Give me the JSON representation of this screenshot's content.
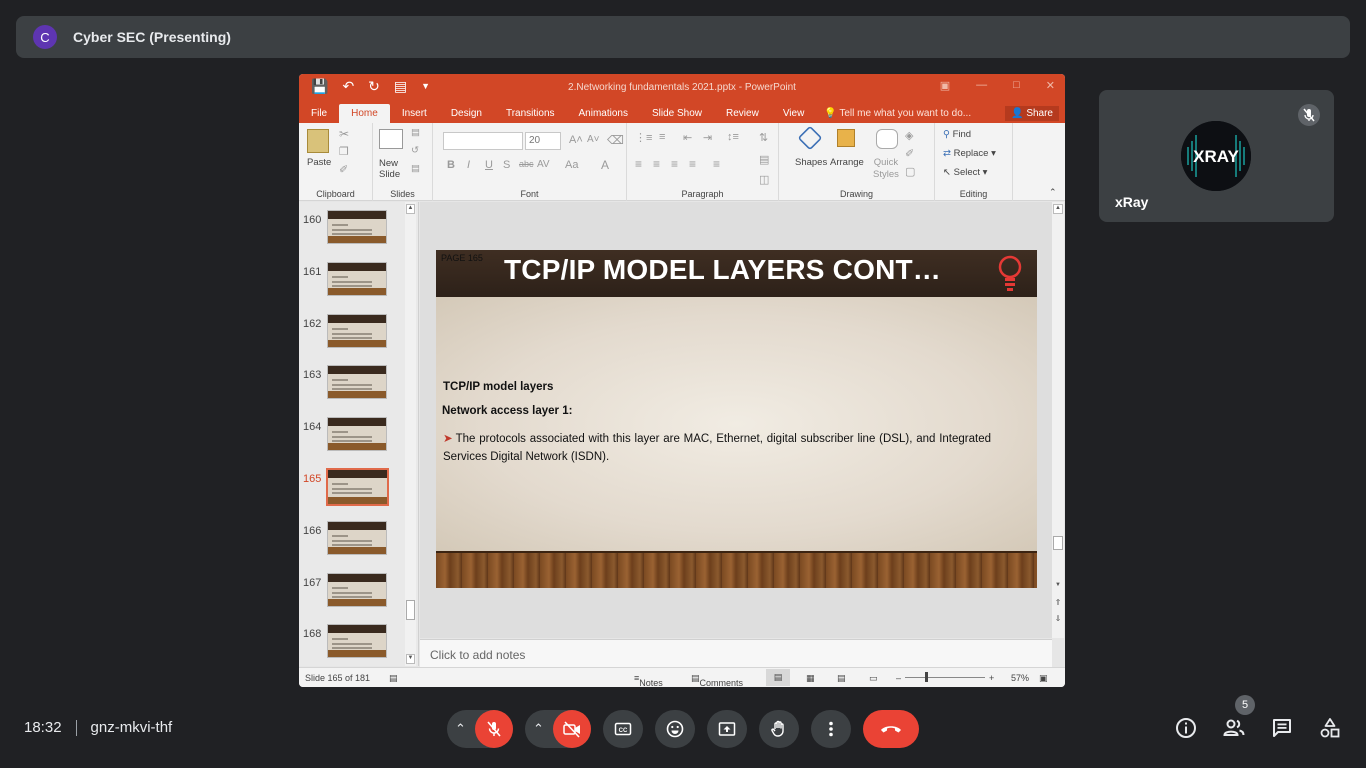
{
  "presenter": {
    "initial": "C",
    "title": "Cyber SEC (Presenting)"
  },
  "ppt": {
    "doc_title": "2.Networking fundamentals 2021.pptx  -  PowerPoint",
    "tabs": [
      "File",
      "Home",
      "Insert",
      "Design",
      "Transitions",
      "Animations",
      "Slide Show",
      "Review",
      "View"
    ],
    "tell_me": "Tell me what you want to do...",
    "share": "Share",
    "ribbon": {
      "paste": "Paste",
      "new_slide": "New\nSlide",
      "font_size": "20",
      "shapes": "Shapes",
      "arrange": "Arrange",
      "quick_styles": "Quick\nStyles",
      "find": "Find",
      "replace": "Replace",
      "select": "Select",
      "groups": [
        "Clipboard",
        "Slides",
        "Font",
        "Paragraph",
        "Drawing",
        "Editing"
      ]
    },
    "thumbnails": [
      {
        "num": "160",
        "selected": false
      },
      {
        "num": "161",
        "selected": false
      },
      {
        "num": "162",
        "selected": false
      },
      {
        "num": "163",
        "selected": false
      },
      {
        "num": "164",
        "selected": false
      },
      {
        "num": "165",
        "selected": true
      },
      {
        "num": "166",
        "selected": false
      },
      {
        "num": "167",
        "selected": false
      },
      {
        "num": "168",
        "selected": false
      }
    ],
    "slide": {
      "page_label": "PAGE 165",
      "title": "TCP/IP MODEL LAYERS CONT…",
      "heading1": "TCP/IP model layers",
      "heading2": "Network access layer 1:",
      "bullet": "The protocols associated with this layer are MAC, Ethernet, digital subscriber line (DSL), and Integrated Services Digital Network (ISDN)."
    },
    "notes_placeholder": "Click to add notes",
    "status": {
      "slide_count": "Slide 165 of 181",
      "notes": "Notes",
      "comments": "Comments",
      "zoom": "57%"
    }
  },
  "participant": {
    "name": "xRay",
    "muted": true,
    "avatar_label": "XRAY"
  },
  "meeting": {
    "time": "18:32",
    "code": "gnz-mkvi-thf",
    "participant_count": "5"
  },
  "colors": {
    "ppt_accent": "#d24726",
    "end_call": "#ea4335",
    "meet_bg": "#202124"
  }
}
